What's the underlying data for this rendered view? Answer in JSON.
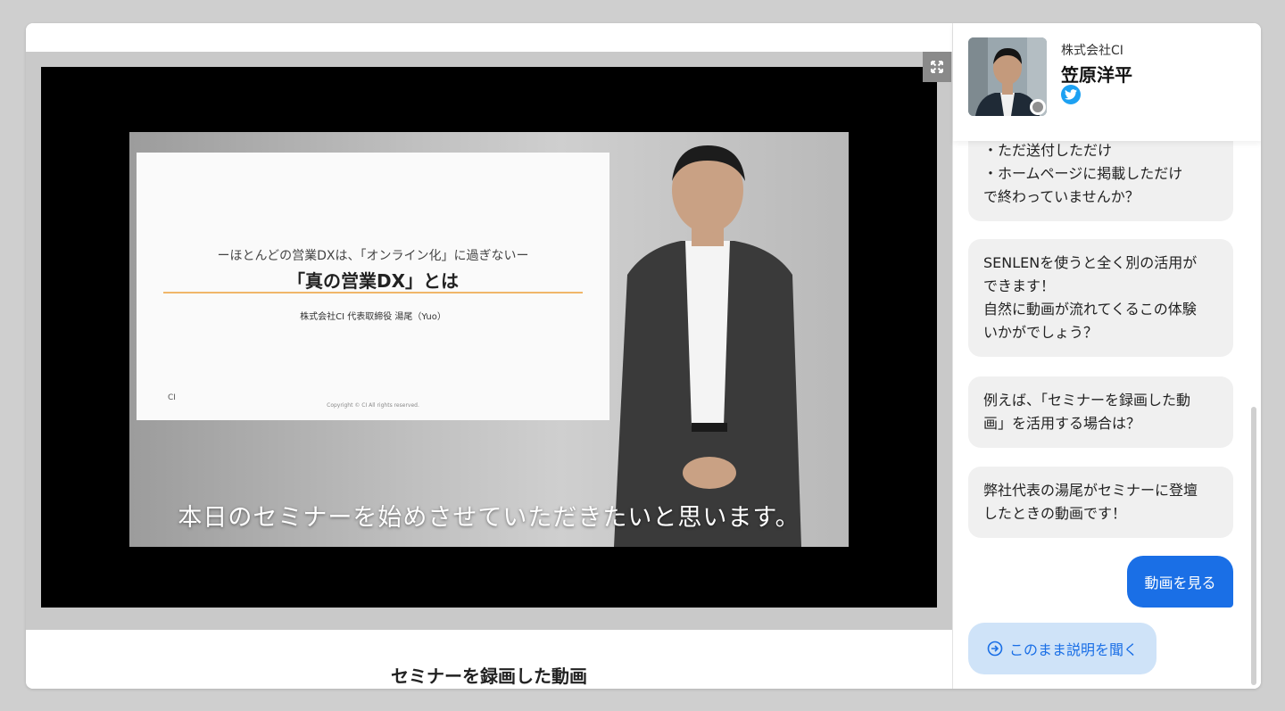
{
  "video": {
    "slide_subtitle": "ーほとんどの営業DXは、「オンライン化」に過ぎないー",
    "slide_title": "「真の営業DX」とは",
    "slide_presenter": "株式会社CI 代表取締役 湯尾（Yuo）",
    "slide_logo": "CI",
    "slide_copyright": "Copyright © CI All rights reserved.",
    "subtitle": "本日のセミナーを始めさせていただきたいと思います。",
    "caption": "セミナーを録画した動画",
    "expand_icon": "expand-icon"
  },
  "chat": {
    "header": {
      "company": "株式会社CI",
      "name": "笠原洋平",
      "social_icon": "twitter-icon",
      "status_color": "#8f8f8f"
    },
    "messages": [
      {
        "lines": [
          "・ただ送付しただけ",
          "・ホームページに掲載しただけ",
          "で終わっていませんか？"
        ]
      },
      {
        "lines": [
          "SENLENを使うと全く別の活用が",
          "できます！",
          "自然に動画が流れてくるこの体験",
          "いかがでしょう？"
        ]
      },
      {
        "lines": [
          "例えば、「セミナーを録画した動",
          "画」を活用する場合は？"
        ]
      },
      {
        "lines": [
          "弊社代表の湯尾がセミナーに登壇",
          "したときの動画です！"
        ]
      }
    ],
    "primary_button": "動画を見る",
    "secondary_button": "このまま説明を聞く",
    "secondary_icon": "arrow-circle-right-icon",
    "accent_color": "#1a6fe6"
  }
}
